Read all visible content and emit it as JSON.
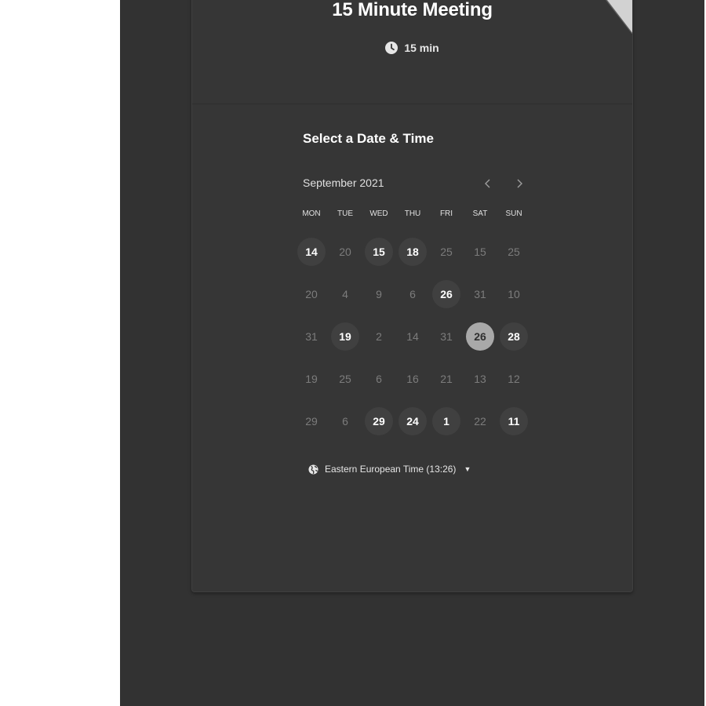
{
  "event": {
    "title": "15 Minute Meeting",
    "duration": "15 min"
  },
  "calendar": {
    "heading": "Select a Date & Time",
    "month": "September 2021",
    "prev_icon": "chevron-left-icon",
    "next_icon": "chevron-right-icon",
    "weekdays": [
      "MON",
      "TUE",
      "WED",
      "THU",
      "FRI",
      "SAT",
      "SUN"
    ],
    "weeks": [
      [
        {
          "n": "14",
          "s": "avail"
        },
        {
          "n": "20",
          "s": ""
        },
        {
          "n": "15",
          "s": "avail"
        },
        {
          "n": "18",
          "s": "avail"
        },
        {
          "n": "25",
          "s": ""
        },
        {
          "n": "15",
          "s": ""
        },
        {
          "n": "25",
          "s": ""
        }
      ],
      [
        {
          "n": "20",
          "s": ""
        },
        {
          "n": "4",
          "s": ""
        },
        {
          "n": "9",
          "s": ""
        },
        {
          "n": "6",
          "s": ""
        },
        {
          "n": "26",
          "s": "avail"
        },
        {
          "n": "31",
          "s": ""
        },
        {
          "n": "10",
          "s": ""
        }
      ],
      [
        {
          "n": "31",
          "s": ""
        },
        {
          "n": "19",
          "s": "avail"
        },
        {
          "n": "2",
          "s": ""
        },
        {
          "n": "14",
          "s": ""
        },
        {
          "n": "31",
          "s": ""
        },
        {
          "n": "26",
          "s": "selected"
        },
        {
          "n": "28",
          "s": "avail"
        }
      ],
      [
        {
          "n": "19",
          "s": ""
        },
        {
          "n": "25",
          "s": ""
        },
        {
          "n": "6",
          "s": ""
        },
        {
          "n": "16",
          "s": ""
        },
        {
          "n": "21",
          "s": ""
        },
        {
          "n": "13",
          "s": ""
        },
        {
          "n": "12",
          "s": ""
        }
      ],
      [
        {
          "n": "29",
          "s": ""
        },
        {
          "n": "6",
          "s": ""
        },
        {
          "n": "29",
          "s": "avail"
        },
        {
          "n": "24",
          "s": "avail"
        },
        {
          "n": "1",
          "s": "avail"
        },
        {
          "n": "22",
          "s": ""
        },
        {
          "n": "11",
          "s": "avail"
        }
      ]
    ]
  },
  "timezone": {
    "label": "Eastern European Time (13:26)"
  },
  "colors": {
    "page": "#323232",
    "card": "#363636",
    "available": "#404040",
    "selected": "#a9a9a9"
  }
}
